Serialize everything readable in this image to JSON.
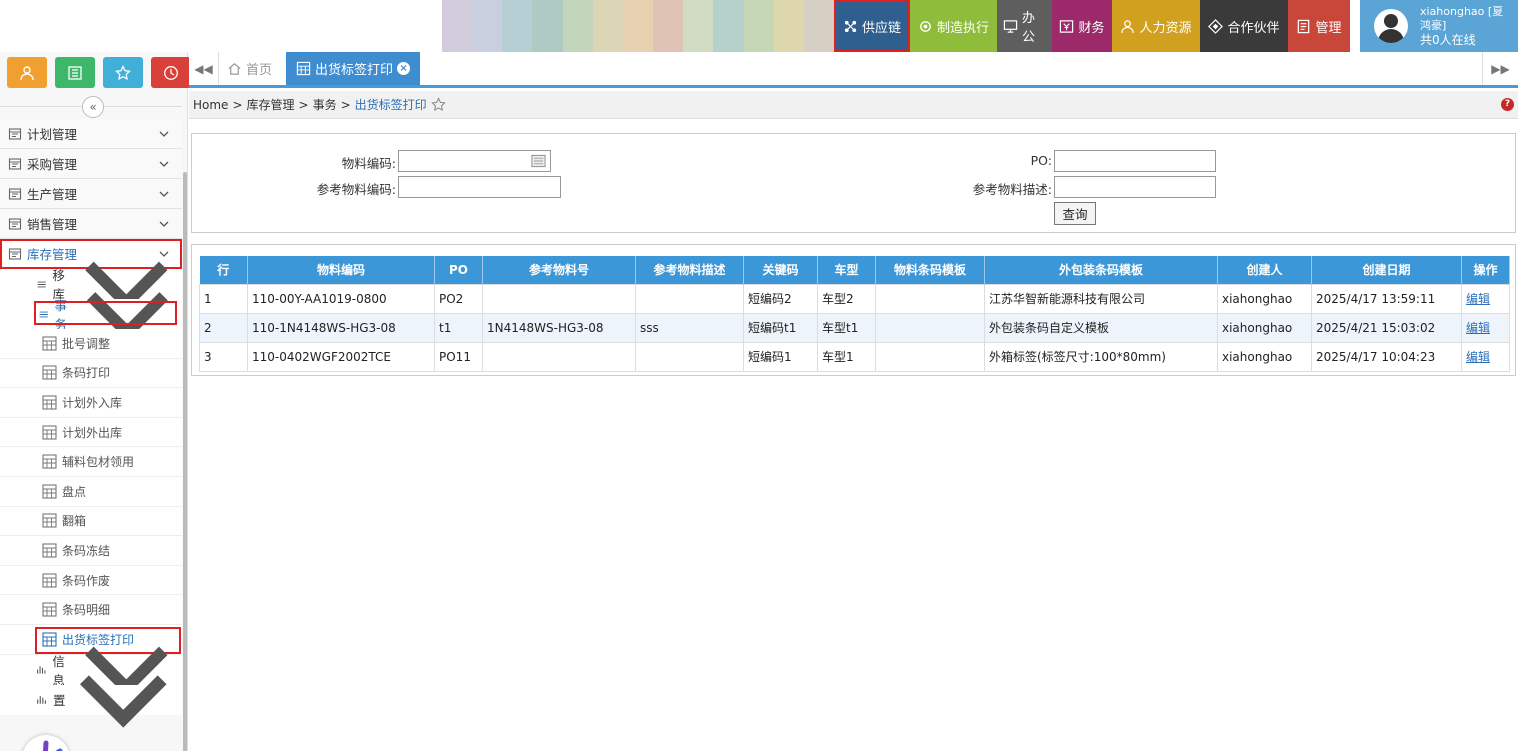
{
  "colors": {
    "accent": "#3c97d8",
    "highlight": "#e02020",
    "menuActive": "#2a70b8"
  },
  "topbar": {
    "modules": [
      {
        "label": "供应链",
        "icon": "network-icon",
        "color": "#2f5f8f",
        "selected": true
      },
      {
        "label": "制造执行",
        "icon": "gear-hand-icon",
        "color": "#8fbc3a"
      },
      {
        "label": "办公",
        "icon": "monitor-icon",
        "color": "#5e5e5e"
      },
      {
        "label": "财务",
        "icon": "yen-icon",
        "color": "#9c2a6b"
      },
      {
        "label": "人力资源",
        "icon": "person-icon",
        "color": "#d1a01f"
      },
      {
        "label": "合作伙伴",
        "icon": "diamond-icon",
        "color": "#3a3a3a"
      },
      {
        "label": "管理",
        "icon": "document-icon",
        "color": "#c9473a"
      }
    ],
    "user": {
      "name": "xiahonghao [夏",
      "name2": "鸿豪]",
      "online": "共0人在线"
    }
  },
  "sidebar": {
    "menu": [
      {
        "label": "计划管理",
        "icon": "calendar-icon"
      },
      {
        "label": "采购管理",
        "icon": "cart-icon"
      },
      {
        "label": "生产管理",
        "icon": "factory-icon"
      },
      {
        "label": "销售管理",
        "icon": "shop-icon"
      },
      {
        "label": "库存管理",
        "icon": "warehouse-icon",
        "active": true
      }
    ],
    "sub": [
      {
        "label": "移库",
        "icon": "layers-icon"
      },
      {
        "label": "事务",
        "icon": "list-icon",
        "open": true
      }
    ],
    "leaves": [
      "批号调整",
      "条码打印",
      "计划外入库",
      "计划外出库",
      "辅料包材领用",
      "盘点",
      "翻箱",
      "条码冻结",
      "条码作废",
      "条码明细",
      "出货标签打印"
    ],
    "bottom": [
      {
        "label": "信息",
        "icon": "bar-chart-icon"
      },
      {
        "label": "置",
        "icon": "settings-icon"
      }
    ]
  },
  "tabs": {
    "home": "首页",
    "current": "出货标签打印"
  },
  "breadcrumb": {
    "home": "Home",
    "l1": "库存管理",
    "l2": "事务",
    "current": "出货标签打印",
    "sep": ">"
  },
  "form": {
    "material_code_label": "物料编码:",
    "ref_material_code_label": "参考物料编码:",
    "po_label": "PO:",
    "ref_material_desc_label": "参考物料描述:",
    "material_code_value": "",
    "ref_material_code_value": "",
    "po_value": "",
    "ref_material_desc_value": "",
    "query_button": "查询"
  },
  "table": {
    "headers": [
      "行",
      "物料编码",
      "PO",
      "参考物料号",
      "参考物料描述",
      "关键码",
      "车型",
      "物料条码模板",
      "外包装条码模板",
      "创建人",
      "创建日期",
      "操作"
    ],
    "rows": [
      [
        "1",
        "110-00Y-AA1019-0800",
        "PO2",
        "",
        "",
        "短编码2",
        "车型2",
        "",
        "江苏华智新能源科技有限公司",
        "xiahonghao",
        "2025/4/17 13:59:11",
        "编辑"
      ],
      [
        "2",
        "110-1N4148WS-HG3-08",
        "t1",
        "1N4148WS-HG3-08",
        "sss",
        "短编码t1",
        "车型t1",
        "",
        "外包装条码自定义模板",
        "xiahonghao",
        "2025/4/21 15:03:02",
        "编辑"
      ],
      [
        "3",
        "110-0402WGF2002TCE",
        "PO11",
        "",
        "",
        "短编码1",
        "车型1",
        "",
        "外箱标签(标签尺寸:100*80mm)",
        "xiahonghao",
        "2025/4/17 10:04:23",
        "编辑"
      ]
    ]
  }
}
